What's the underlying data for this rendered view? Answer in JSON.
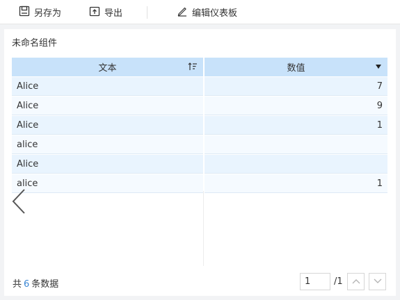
{
  "toolbar": {
    "save_as_label": "另存为",
    "export_label": "导出",
    "edit_dashboard_label": "编辑仪表板"
  },
  "widget": {
    "title": "未命名组件"
  },
  "table": {
    "columns": [
      "文本",
      "数值"
    ],
    "rows": [
      {
        "text": "Alice",
        "value": "7"
      },
      {
        "text": "Alice",
        "value": "9"
      },
      {
        "text": "Alice",
        "value": "1"
      },
      {
        "text": "alice",
        "value": ""
      },
      {
        "text": "Alice",
        "value": ""
      },
      {
        "text": "alice",
        "value": "1"
      }
    ]
  },
  "footer": {
    "prefix": "共",
    "count": "6",
    "suffix": "条数据"
  },
  "pager": {
    "current_page": "1",
    "total_pages": "/1"
  },
  "colors": {
    "header_bg": "#c8e2fa",
    "row_odd_bg": "#e9f4fe",
    "row_even_bg": "#f5faff",
    "accent": "#3a86d4"
  }
}
